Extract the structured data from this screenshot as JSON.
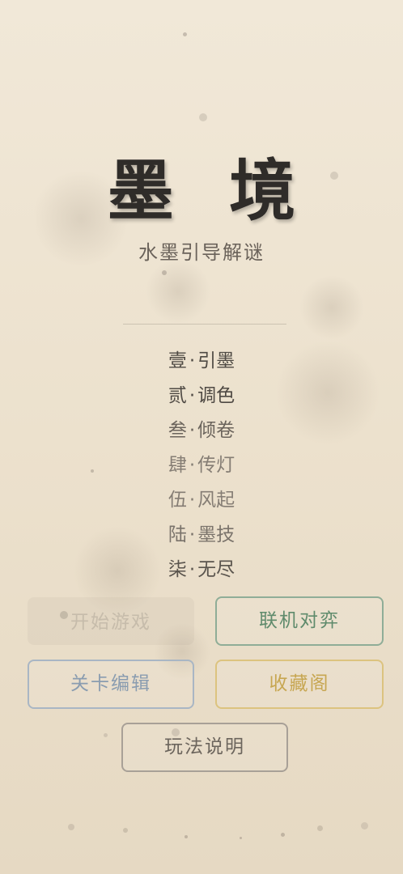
{
  "header": {
    "title": "墨 境",
    "subtitle": "水墨引导解谜"
  },
  "chapters": [
    {
      "num": "壹",
      "sep": "·",
      "name": "引墨",
      "color": "#4f4a44"
    },
    {
      "num": "贰",
      "sep": "·",
      "name": "调色",
      "color": "#4f4a44"
    },
    {
      "num": "叁",
      "sep": "·",
      "name": "倾卷",
      "color": "#6b645c"
    },
    {
      "num": "肆",
      "sep": "·",
      "name": "传灯",
      "color": "#857d74"
    },
    {
      "num": "伍",
      "sep": "·",
      "name": "风起",
      "color": "#857d74"
    },
    {
      "num": "陆",
      "sep": "·",
      "name": "墨技",
      "color": "#7a736b"
    },
    {
      "num": "柒",
      "sep": "·",
      "name": "无尽",
      "color": "#5a544d"
    }
  ],
  "buttons": {
    "start": "开始游戏",
    "online": "联机对弈",
    "level_editor": "关卡编辑",
    "collection": "收藏阁",
    "help": "玩法说明"
  },
  "colors": {
    "background": "#ece1cd",
    "online": "#5f8b6c",
    "level_editor": "#8a9cb0",
    "collection": "#c7a651",
    "help": "#6c655d",
    "start_disabled": "#b9b0a6"
  }
}
